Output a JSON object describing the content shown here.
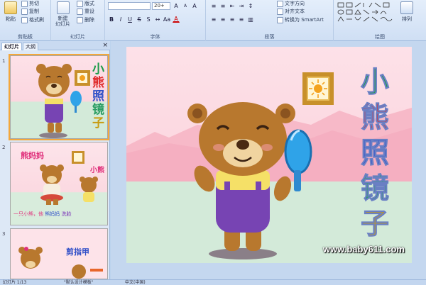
{
  "ribbon": {
    "clipboard": {
      "paste": "粘贴",
      "cut": "剪切",
      "copy": "复制",
      "format_painter": "格式刷",
      "label": "剪贴板"
    },
    "slides": {
      "new_slide": "新建\n幻灯片",
      "layout": "版式",
      "reset": "重设",
      "delete": "删除",
      "label": "幻灯片"
    },
    "font": {
      "font_size": "20+",
      "label": "字体",
      "bold": "B",
      "italic": "I",
      "underline": "U",
      "strike": "S",
      "grow": "A",
      "shrink": "A",
      "clear": "A",
      "color": "A"
    },
    "paragraph": {
      "text_direction": "文字方向",
      "align_text": "对齐文本",
      "smartart": "转换为 SmartArt",
      "label": "段落"
    },
    "drawing": {
      "arrange": "排列",
      "quick_styles": "快速样式",
      "label": "绘图"
    }
  },
  "panel": {
    "tabs": [
      "幻灯片",
      "大纲"
    ],
    "close": "×",
    "slides": [
      {
        "number": "1",
        "title": [
          "小",
          "熊",
          "照",
          "镜",
          "子"
        ]
      },
      {
        "number": "2",
        "mama": "熊妈妈",
        "title": "小熊",
        "caption_a": "一只小熊，他",
        "caption_b": "熊妈妈",
        "caption_c": "洗脸"
      },
      {
        "number": "3",
        "title": "剪指甲"
      }
    ]
  },
  "slide": {
    "title": [
      "小",
      "熊",
      "照",
      "镜",
      "子"
    ],
    "watermark": "www.baby611.com"
  },
  "status": {
    "slide_count": "幻灯片 1/13",
    "theme": "\"默认设计模板\"",
    "language": "中文(中国)"
  },
  "colors": {
    "ribbon": "#dbe7f7",
    "slide_bg": "#fde1e8",
    "bear": "#b8782e",
    "overalls": "#7744b3",
    "frame": "#c8902a"
  }
}
